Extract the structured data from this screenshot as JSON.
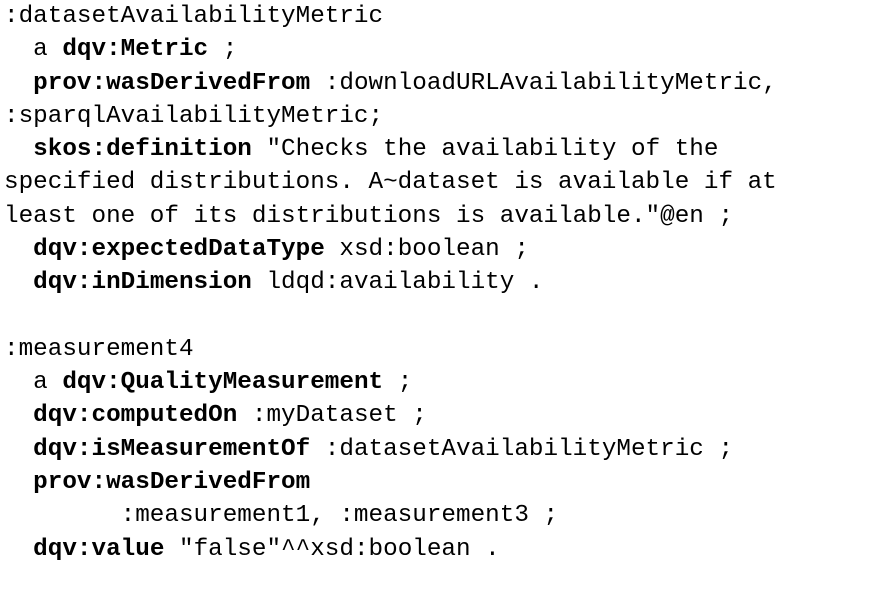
{
  "lines": [
    {
      "segs": [
        {
          "t": ":datasetAvailabilityMetric",
          "b": false
        }
      ]
    },
    {
      "segs": [
        {
          "t": "  a ",
          "b": false
        },
        {
          "t": "dqv:Metric",
          "b": true
        },
        {
          "t": " ;",
          "b": false
        }
      ]
    },
    {
      "segs": [
        {
          "t": "  ",
          "b": false
        },
        {
          "t": "prov:wasDerivedFrom",
          "b": true
        },
        {
          "t": " :downloadURLAvailabilityMetric,",
          "b": false
        }
      ]
    },
    {
      "segs": [
        {
          "t": ":sparqlAvailabilityMetric;",
          "b": false
        }
      ]
    },
    {
      "segs": [
        {
          "t": "  ",
          "b": false
        },
        {
          "t": "skos:definition",
          "b": true
        },
        {
          "t": " \"Checks the availability of the ",
          "b": false
        }
      ]
    },
    {
      "segs": [
        {
          "t": "specified distributions. A~dataset is available if at ",
          "b": false
        }
      ]
    },
    {
      "segs": [
        {
          "t": "least one of its distributions is available.\"@en ;",
          "b": false
        }
      ]
    },
    {
      "segs": [
        {
          "t": "  ",
          "b": false
        },
        {
          "t": "dqv:expectedDataType",
          "b": true
        },
        {
          "t": " xsd:boolean ;",
          "b": false
        }
      ]
    },
    {
      "segs": [
        {
          "t": "  ",
          "b": false
        },
        {
          "t": "dqv:inDimension",
          "b": true
        },
        {
          "t": " ldqd:availability .",
          "b": false
        }
      ]
    },
    {
      "segs": [
        {
          "t": " ",
          "b": false
        }
      ]
    },
    {
      "segs": [
        {
          "t": ":measurement4",
          "b": false
        }
      ]
    },
    {
      "segs": [
        {
          "t": "  a ",
          "b": false
        },
        {
          "t": "dqv:QualityMeasurement",
          "b": true
        },
        {
          "t": " ;",
          "b": false
        }
      ]
    },
    {
      "segs": [
        {
          "t": "  ",
          "b": false
        },
        {
          "t": "dqv:computedOn",
          "b": true
        },
        {
          "t": " :myDataset ;",
          "b": false
        }
      ]
    },
    {
      "segs": [
        {
          "t": "  ",
          "b": false
        },
        {
          "t": "dqv:isMeasurementOf",
          "b": true
        },
        {
          "t": " :datasetAvailabilityMetric ;",
          "b": false
        }
      ]
    },
    {
      "segs": [
        {
          "t": "  ",
          "b": false
        },
        {
          "t": "prov:wasDerivedFrom",
          "b": true
        }
      ]
    },
    {
      "segs": [
        {
          "t": "        :measurement1, :measurement3 ;",
          "b": false
        }
      ]
    },
    {
      "segs": [
        {
          "t": "  ",
          "b": false
        },
        {
          "t": "dqv:value",
          "b": true
        },
        {
          "t": " \"false\"^^xsd:boolean .",
          "b": false
        }
      ]
    }
  ]
}
